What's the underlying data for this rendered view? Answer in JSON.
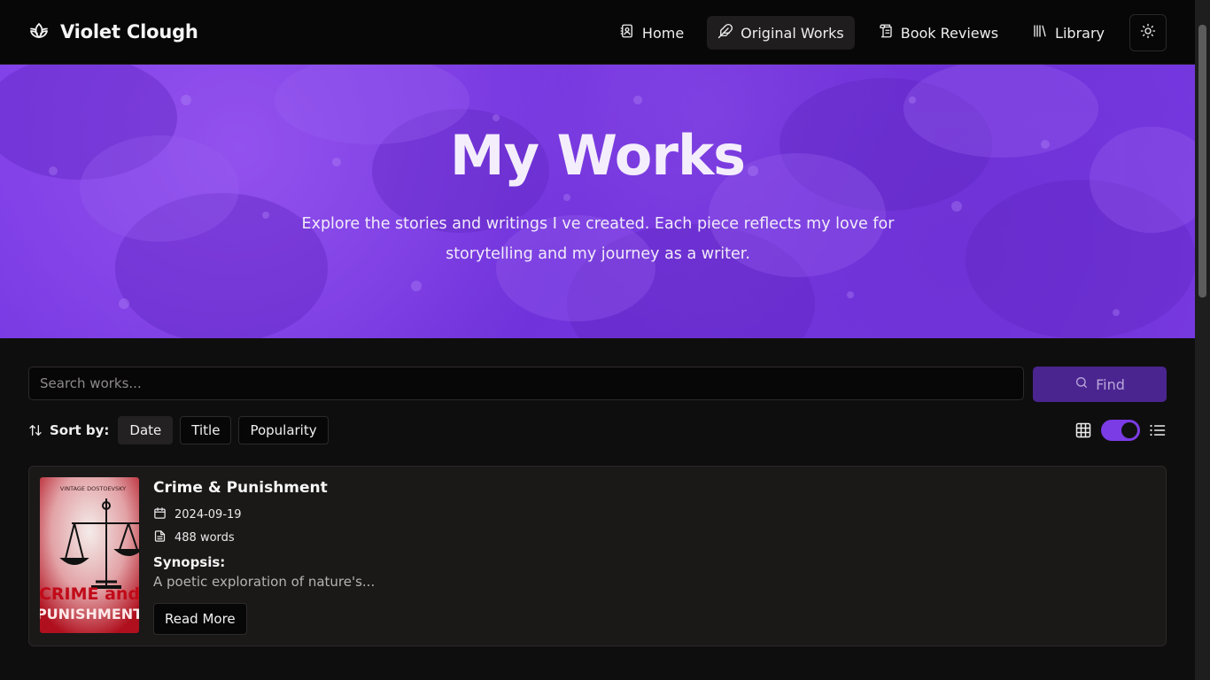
{
  "header": {
    "brand": "Violet Clough",
    "nav": [
      {
        "label": "Home",
        "icon": "contact-book-icon"
      },
      {
        "label": "Original Works",
        "icon": "feather-icon"
      },
      {
        "label": "Book Reviews",
        "icon": "scroll-icon"
      },
      {
        "label": "Library",
        "icon": "library-icon"
      }
    ],
    "active_nav": "Original Works",
    "theme_toggle_icon": "sun-icon"
  },
  "hero": {
    "title": "My Works",
    "subtitle": "Explore the stories and writings I ve created. Each piece reflects my love for storytelling and my journey as a writer."
  },
  "search": {
    "placeholder": "Search works...",
    "button_label": "Find"
  },
  "sort": {
    "label": "Sort by:",
    "options": [
      "Date",
      "Title",
      "Popularity"
    ],
    "selected": "Date"
  },
  "view": {
    "grid_icon": "grid-icon",
    "list_icon": "list-icon",
    "toggle_on": true
  },
  "works": [
    {
      "title": "Crime & Punishment",
      "date": "2024-09-19",
      "words": "488 words",
      "synopsis_label": "Synopsis:",
      "synopsis": "A poetic exploration of nature's...",
      "button": "Read More",
      "cover_imprint": "VINTAGE DOSTOEVSKY",
      "cover_title_line1": "CRIME and",
      "cover_title_line2": "PUNISHMENT"
    }
  ],
  "colors": {
    "accent": "#7b3ce6",
    "find_button": "#4a2590",
    "background": "#0f0e0e"
  }
}
